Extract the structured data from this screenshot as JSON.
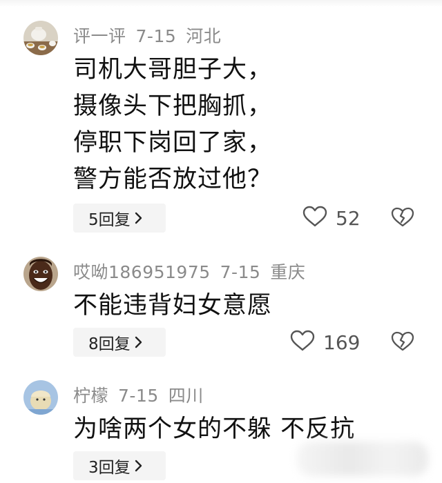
{
  "comments": [
    {
      "username": "评一评",
      "date": "7-15",
      "location": "河北",
      "lines": [
        "司机大哥胆子大，",
        "摄像头下把胸抓，",
        "停职下岗回了家，",
        "警方能否放过他？"
      ],
      "reply_label": "5回复",
      "likes": "52",
      "avatar_icon": "tea-set-avatar"
    },
    {
      "username": "哎呦186951975",
      "date": "7-15",
      "location": "重庆",
      "lines": [
        "不能违背妇女意愿"
      ],
      "reply_label": "8回复",
      "likes": "169",
      "avatar_icon": "smiling-man-avatar"
    },
    {
      "username": "柠檬",
      "date": "7-15",
      "location": "四川",
      "lines": [
        "为啥两个女的不躲 不反抗"
      ],
      "reply_label": "3回复",
      "avatar_icon": "cartoon-avatar"
    }
  ],
  "icons": {
    "like": "heart-outline-icon",
    "dislike": "broken-heart-icon",
    "chevron": "chevron-right-icon"
  },
  "colors": {
    "meta_text": "#8a8a8a",
    "body_text": "#111111",
    "reply_bg": "#f4f4f4"
  }
}
